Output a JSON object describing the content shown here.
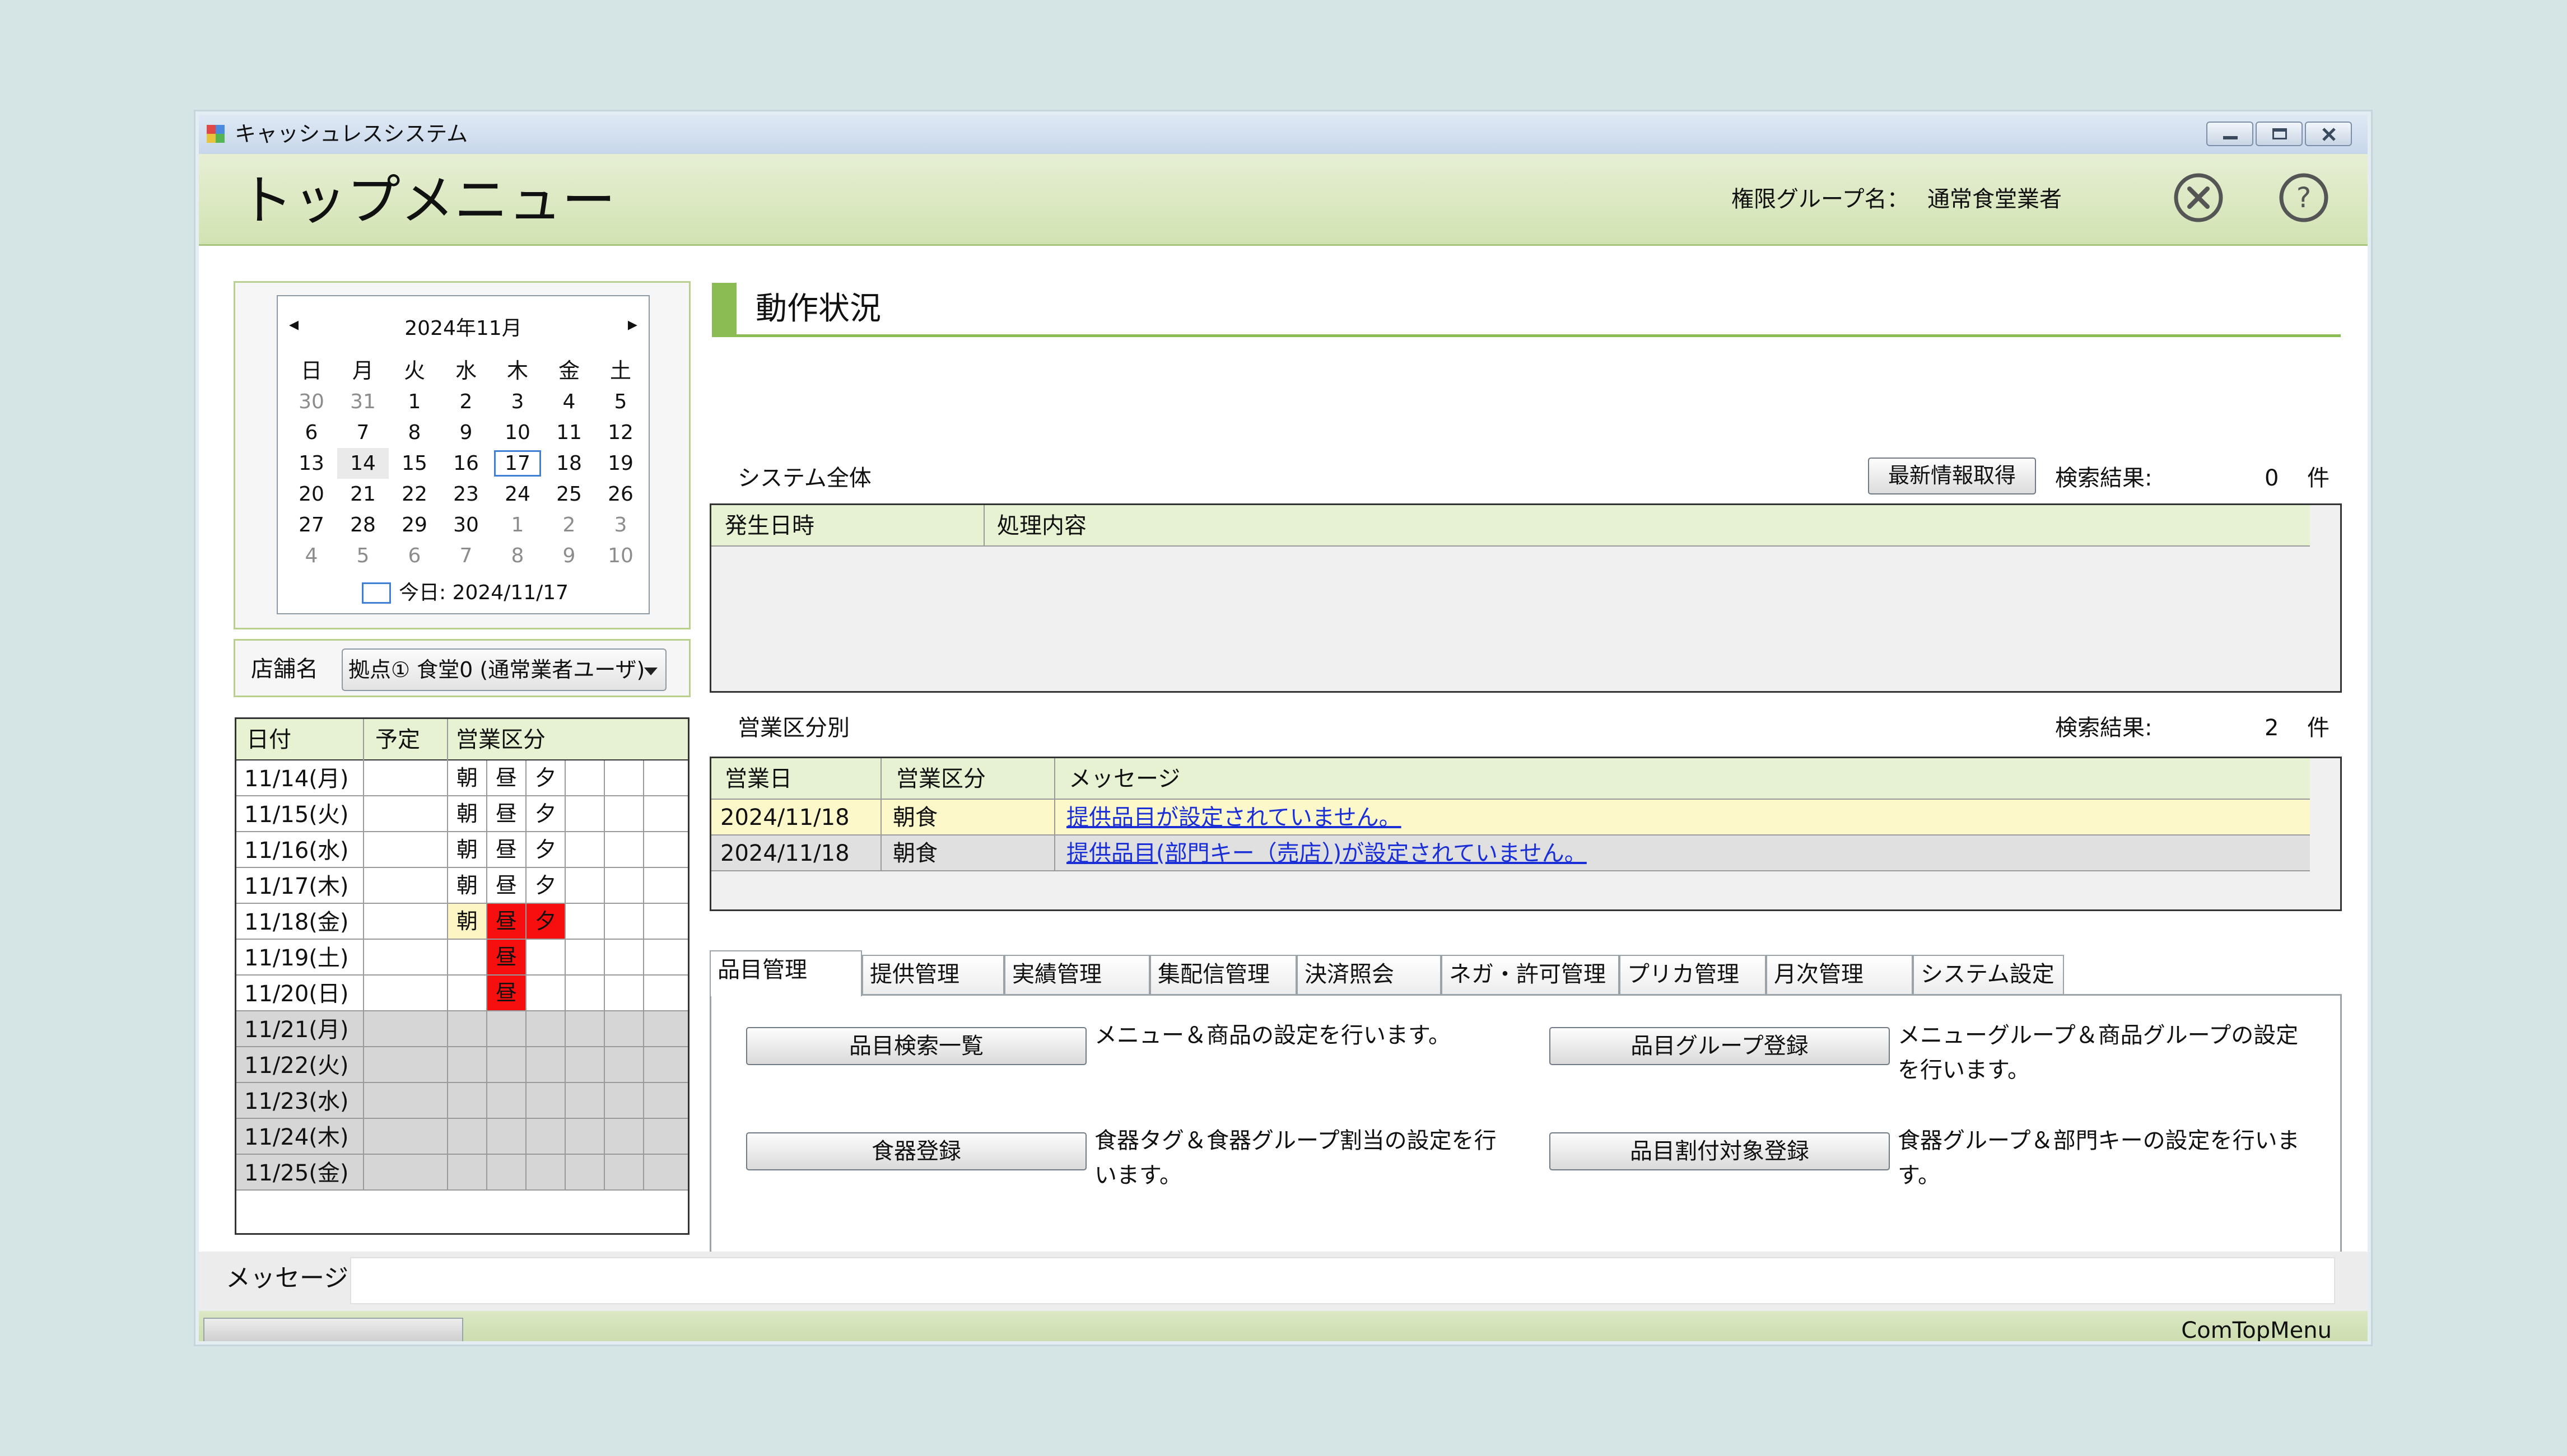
{
  "window": {
    "title": "キャッシュレスシステム",
    "controls": [
      "minimize-icon",
      "maximize-icon",
      "close-icon"
    ]
  },
  "header": {
    "page_title": "トップメニュー",
    "permission_label": "権限グループ名：",
    "permission_value": "通常食堂業者",
    "icons": [
      "close-circle-icon",
      "help-icon"
    ]
  },
  "calendar": {
    "month": "2024年11月",
    "weekdays": [
      "日",
      "月",
      "火",
      "水",
      "木",
      "金",
      "土"
    ],
    "weeks": [
      [
        "30",
        "31",
        "1",
        "2",
        "3",
        "4",
        "5"
      ],
      [
        "6",
        "7",
        "8",
        "9",
        "10",
        "11",
        "12"
      ],
      [
        "13",
        "14",
        "15",
        "16",
        "17",
        "18",
        "19"
      ],
      [
        "20",
        "21",
        "22",
        "23",
        "24",
        "25",
        "26"
      ],
      [
        "27",
        "28",
        "29",
        "30",
        "1",
        "2",
        "3"
      ],
      [
        "4",
        "5",
        "6",
        "7",
        "8",
        "9",
        "10"
      ]
    ],
    "today_label": "今日: 2024/11/17"
  },
  "store": {
    "label": "店舗名",
    "selected": "拠点① 食堂0 (通常業者ユーザ)"
  },
  "schedule": {
    "headers": [
      "日付",
      "予定",
      "営業区分"
    ],
    "rows": [
      {
        "date": "11/14(月)",
        "cells": [
          "朝",
          "昼",
          "夕"
        ],
        "status": [
          "",
          "",
          ""
        ]
      },
      {
        "date": "11/15(火)",
        "cells": [
          "朝",
          "昼",
          "夕"
        ],
        "status": [
          "",
          "",
          ""
        ]
      },
      {
        "date": "11/16(水)",
        "cells": [
          "朝",
          "昼",
          "夕"
        ],
        "status": [
          "",
          "",
          ""
        ]
      },
      {
        "date": "11/17(木)",
        "cells": [
          "朝",
          "昼",
          "夕"
        ],
        "status": [
          "",
          "",
          ""
        ]
      },
      {
        "date": "11/18(金)",
        "cells": [
          "朝",
          "昼",
          "夕"
        ],
        "status": [
          "yellow",
          "red",
          "red"
        ]
      },
      {
        "date": "11/19(土)",
        "cells": [
          "",
          "昼",
          ""
        ],
        "status": [
          "",
          "red",
          ""
        ]
      },
      {
        "date": "11/20(日)",
        "cells": [
          "",
          "昼",
          ""
        ],
        "status": [
          "",
          "red",
          ""
        ]
      },
      {
        "date": "11/21(月)",
        "cells": [
          "",
          "",
          ""
        ],
        "status": [
          "",
          "",
          ""
        ]
      },
      {
        "date": "11/22(火)",
        "cells": [
          "",
          "",
          ""
        ],
        "status": [
          "",
          "",
          ""
        ]
      },
      {
        "date": "11/23(水)",
        "cells": [
          "",
          "",
          ""
        ],
        "status": [
          "",
          "",
          ""
        ]
      },
      {
        "date": "11/24(木)",
        "cells": [
          "",
          "",
          ""
        ],
        "status": [
          "",
          "",
          ""
        ]
      },
      {
        "date": "11/25(金)",
        "cells": [
          "",
          "",
          ""
        ],
        "status": [
          "",
          "",
          ""
        ]
      }
    ]
  },
  "status_section": {
    "title": "動作状況",
    "system": {
      "label": "システム全体",
      "refresh_button": "最新情報取得",
      "result_label": "検索結果:",
      "result_count": "0",
      "result_unit": "件",
      "columns": [
        "発生日時",
        "処理内容"
      ]
    },
    "business": {
      "label": "営業区分別",
      "result_label": "検索結果:",
      "result_count": "2",
      "result_unit": "件",
      "columns": [
        "営業日",
        "営業区分",
        "メッセージ"
      ],
      "rows": [
        {
          "date": "2024/11/18",
          "kubun": "朝食",
          "message": "提供品目が設定されていません。"
        },
        {
          "date": "2024/11/18",
          "kubun": "朝食",
          "message": "提供品目(部門キー（売店）)が設定されていません。"
        }
      ]
    }
  },
  "tabs": [
    "品目管理",
    "提供管理",
    "実績管理",
    "集配信管理",
    "決済照会",
    "ネガ・許可管理",
    "プリカ管理",
    "月次管理",
    "システム設定"
  ],
  "functions": [
    {
      "button": "品目検索一覧",
      "desc": "メニュー＆商品の設定を行います。"
    },
    {
      "button": "品目グループ登録",
      "desc": "メニューグループ＆商品グループの設定を行います。"
    },
    {
      "button": "食器登録",
      "desc": "食器タグ＆食器グループ割当の設定を行います。"
    },
    {
      "button": "品目割付対象登録",
      "desc": "食器グループ＆部門キーの設定を行います。"
    }
  ],
  "message_bar": {
    "label": "メッセージ",
    "value": ""
  },
  "statusbar": {
    "form_name": "ComTopMenu"
  },
  "colors": {
    "header_green": "#d2e3b2",
    "accent_green": "#8bbb53",
    "alert_red": "#f70f0f",
    "highlight_yellow": "#fef5c4",
    "link_blue": "#1a2fd6"
  }
}
